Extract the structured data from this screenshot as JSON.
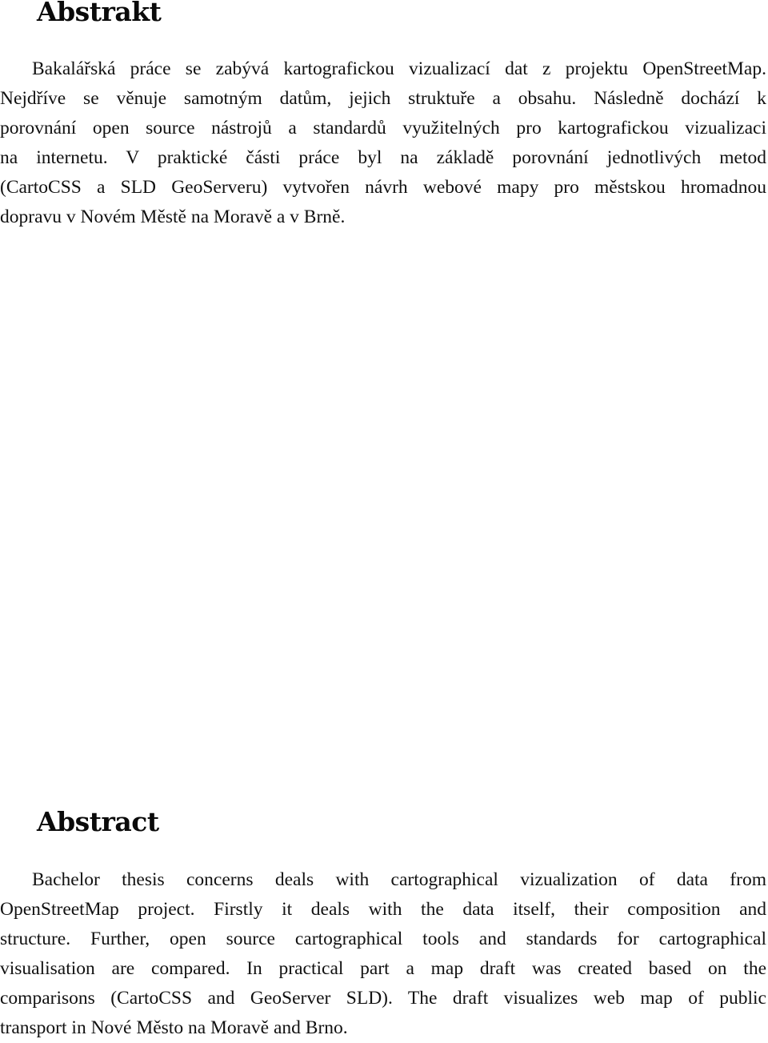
{
  "document": {
    "czech_section": {
      "heading": "Abstrakt",
      "lines": [
        "Bakalářská práce se zabývá kartografickou vizualizací dat z projektu OpenStreetMap.",
        "Nejdříve se věnuje samotným datům, jejich struktuře a obsahu. Následně dochází k",
        "porovnání open source nástrojů a standardů využitelných pro kartografickou vizualizaci",
        "na internetu. V praktické části práce byl na základě porovnání jednotlivých metod",
        "(CartoCSS a SLD GeoServeru) vytvořen návrh webové mapy pro městskou hromadnou",
        "dopravu v Novém Městě na Moravě a v Brně."
      ]
    },
    "english_section": {
      "heading": "Abstract",
      "lines": [
        "Bachelor thesis concerns deals with cartographical vizualization of data from",
        "OpenStreetMap project. Firstly it deals with the data itself, their composition and",
        "structure. Further, open source cartographical tools and standards for cartographical",
        "visualisation are compared. In practical part a map draft was created based on the",
        "comparisons (CartoCSS and GeoServer SLD). The draft visualizes web map of public",
        "transport in Nové Město na Moravě and Brno."
      ]
    }
  }
}
